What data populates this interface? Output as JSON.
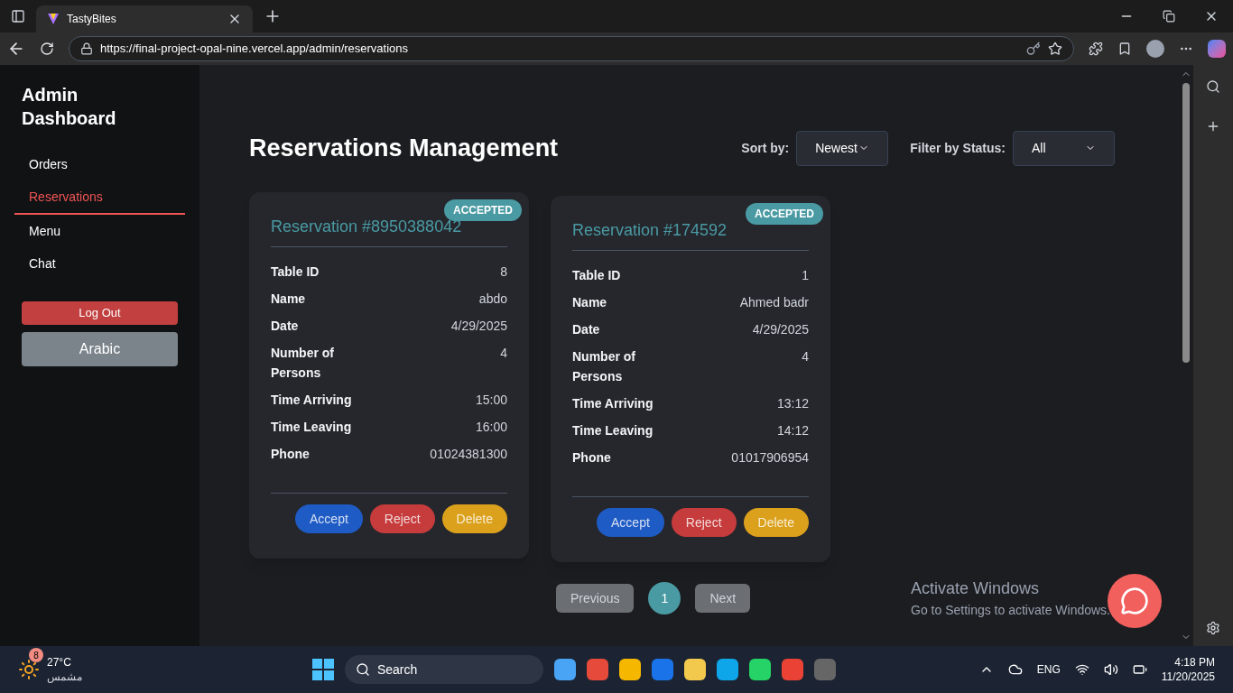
{
  "browser": {
    "tab_title": "TastyBites",
    "url": "https://final-project-opal-nine.vercel.app/admin/reservations"
  },
  "sidebar": {
    "title": "Admin Dashboard",
    "items": [
      {
        "label": "Orders",
        "selected": false
      },
      {
        "label": "Reservations",
        "selected": true
      },
      {
        "label": "Menu",
        "selected": false
      },
      {
        "label": "Chat",
        "selected": false
      }
    ],
    "logout": "Log Out",
    "language": "Arabic"
  },
  "header": {
    "title": "Reservations Management",
    "sort": {
      "label": "Sort by:",
      "value": "Newest"
    },
    "filter": {
      "label": "Filter by Status:",
      "value": "All"
    }
  },
  "reservations": [
    {
      "title": "Reservation #8950388042",
      "status": "ACCEPTED",
      "fields": [
        {
          "label": "Table ID",
          "value": "8"
        },
        {
          "label": "Name",
          "value": "abdo"
        },
        {
          "label": "Date",
          "value": "4/29/2025"
        },
        {
          "label": "Number of Persons",
          "value": "4"
        },
        {
          "label": "Time Arriving",
          "value": "15:00"
        },
        {
          "label": "Time Leaving",
          "value": "16:00"
        },
        {
          "label": "Phone",
          "value": "01024381300"
        }
      ],
      "actions": [
        {
          "label": "Accept",
          "kind": "accept"
        },
        {
          "label": "Reject",
          "kind": "reject"
        },
        {
          "label": "Delete",
          "kind": "delete"
        }
      ]
    },
    {
      "title": "Reservation #174592",
      "status": "ACCEPTED",
      "fields": [
        {
          "label": "Table ID",
          "value": "1"
        },
        {
          "label": "Name",
          "value": "Ahmed badr"
        },
        {
          "label": "Date",
          "value": "4/29/2025"
        },
        {
          "label": "Number of Persons",
          "value": "4"
        },
        {
          "label": "Time Arriving",
          "value": "13:12"
        },
        {
          "label": "Time Leaving",
          "value": "14:12"
        },
        {
          "label": "Phone",
          "value": "01017906954"
        }
      ],
      "actions": [
        {
          "label": "Accept",
          "kind": "accept"
        },
        {
          "label": "Reject",
          "kind": "reject"
        },
        {
          "label": "Delete",
          "kind": "delete"
        }
      ]
    }
  ],
  "pagination": [
    {
      "label": "Previous",
      "selected": false
    },
    {
      "label": "1",
      "selected": true
    },
    {
      "label": "Next",
      "selected": false
    }
  ],
  "windows_notice": {
    "title": "Activate Windows",
    "text": "Go to Settings to activate Windows."
  },
  "taskbar": {
    "weather": {
      "temp": "27°C",
      "condition": "مشمس",
      "badge": "8"
    },
    "search": "Search",
    "language": "ENG",
    "time": "4:18 PM",
    "date": "11/20/2025"
  }
}
